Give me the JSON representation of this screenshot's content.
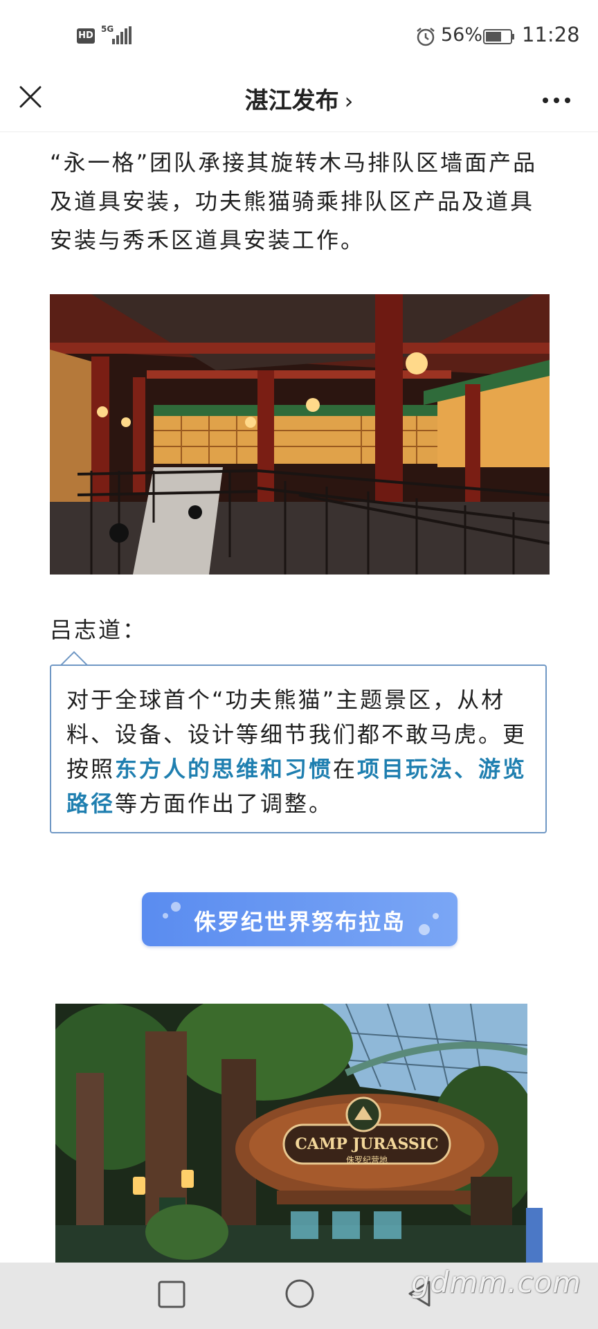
{
  "status_bar": {
    "hd": "HD",
    "network": "5G",
    "battery": "56%",
    "time": "11:28",
    "icons": [
      "signal-icon",
      "alarm-icon",
      "battery-icon"
    ]
  },
  "header": {
    "title": "湛江发布",
    "chevron": "›",
    "close_icon": "close-icon",
    "more_icon": "more-icon"
  },
  "article": {
    "paragraph": "“永一格”团队承接其旋转木马排队区墙面产品及道具安装，功夫熊猫骑乘排队区产品及道具安装与秀禾区道具安装工作。",
    "speaker": "吕志道：",
    "quote": {
      "part1": "对于全球首个“功夫熊猫”主题景区，从材料、设备、设计等细节我们都不敢马虎。更按照",
      "highlight1": "东方人的思维和习惯",
      "part2": "在",
      "highlight2": "项目玩法、游览路径",
      "part3": "等方面作出了调整。"
    },
    "section_label": "侏罗纪世界努布拉岛",
    "photo2_sign_main": "CAMP JURASSIC",
    "photo2_sign_sub": "侏罗纪营地"
  },
  "nav": {
    "back_icon": "back-icon",
    "home_icon": "home-icon",
    "recent_icon": "recent-apps-icon"
  },
  "watermark": "gdmm.com",
  "colors": {
    "highlight": "#1f7fb0",
    "quote_border": "#6f97c4",
    "pill": "#5a8cf0"
  }
}
